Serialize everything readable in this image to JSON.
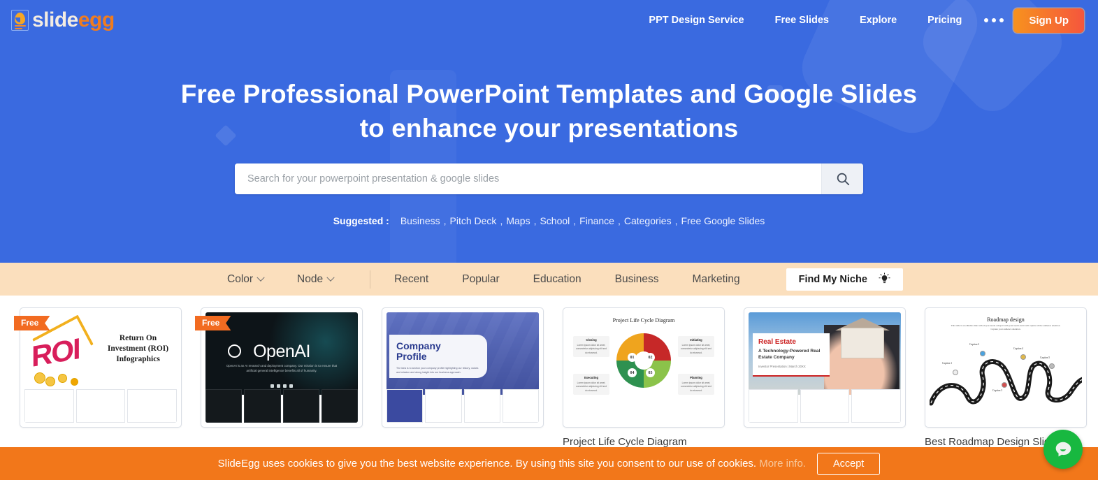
{
  "header": {
    "logo": {
      "part1": "slide",
      "part2": "egg",
      "icon": "egg-document-icon"
    },
    "nav": [
      {
        "label": "PPT Design Service"
      },
      {
        "label": "Free Slides"
      },
      {
        "label": "Explore"
      },
      {
        "label": "Pricing"
      }
    ],
    "more_icon": "ellipsis-icon",
    "signup_label": "Sign Up"
  },
  "hero": {
    "headline_line1": "Free Professional PowerPoint Templates and Google Slides",
    "headline_line2": "to enhance your presentations",
    "search": {
      "placeholder": "Search for your powerpoint presentation & google slides",
      "value": "",
      "button_icon": "search-icon"
    },
    "suggested_label": "Suggested :",
    "suggested": [
      "Business",
      "Pitch Deck",
      "Maps",
      "School",
      "Finance",
      "Categories",
      "Free Google Slides"
    ],
    "separator": ","
  },
  "filterbar": {
    "dropdowns": [
      {
        "label": "Color",
        "icon": "chevron-down-icon"
      },
      {
        "label": "Node",
        "icon": "chevron-down-icon"
      }
    ],
    "links": [
      "Recent",
      "Popular",
      "Education",
      "Business",
      "Marketing"
    ],
    "niche_button": {
      "label": "Find My Niche",
      "icon": "lightbulb-icon"
    }
  },
  "cards": [
    {
      "badge": "Free",
      "title": "",
      "art": {
        "kind": "roi",
        "heading": "Return On Investment (ROI) Infographics",
        "word": "ROI"
      }
    },
    {
      "badge": "Free",
      "title": "",
      "art": {
        "kind": "openai",
        "heading": "OpenAI",
        "subtext": "OpenAI is an AI research and deployment company. Our mission is to ensure that artificial general intelligence benefits all of humanity."
      }
    },
    {
      "badge": "",
      "title": "",
      "art": {
        "kind": "company-profile",
        "heading1": "Company",
        "heading2": "Profile",
        "subtext": "The idea is to section your company profile highlighting our history, values and mission and along insight into our business approach."
      }
    },
    {
      "badge": "",
      "title": "Project Life Cycle Diagram PowerPoint And Google Slides",
      "art": {
        "kind": "life-cycle",
        "heading": "Project Life Cycle Diagram",
        "numbers": [
          "01",
          "02",
          "03",
          "04"
        ],
        "labels": [
          {
            "title": "Closing",
            "body": "Lorem ipsum dolor sit amet, consectetur adipiscing elit sed do eiusmod."
          },
          {
            "title": "Initiating",
            "body": "Lorem ipsum dolor sit amet, consectetur adipiscing elit sed do eiusmod."
          },
          {
            "title": "Executing",
            "body": "Lorem ipsum dolor sit amet, consectetur adipiscing elit sed do eiusmod."
          },
          {
            "title": "Planning",
            "body": "Lorem ipsum dolor sit amet, consectetur adipiscing elit sed do eiusmod."
          }
        ]
      }
    },
    {
      "badge": "",
      "title": "",
      "art": {
        "kind": "real-estate",
        "heading": "Real Estate",
        "subheading": "A Technology-Powered Real Estate Company",
        "meta": "Investor Presentation | March 20XX"
      }
    },
    {
      "badge": "",
      "title": "Best Roadmap Design Slides Templates Presentations",
      "art": {
        "kind": "roadmap",
        "heading": "Roadmap design",
        "subtext": "This slide is an editable slide with all you needs. Adapt it with your needs and it will capture all the audience attention. Capture your audience attention.",
        "captions": [
          "Caption 1",
          "Caption 2",
          "Caption 3",
          "Caption 4",
          "Caption 5"
        ]
      }
    }
  ],
  "cookie": {
    "text": "SlideEgg uses cookies to give you the best website experience. By using this site you consent to our use of cookies.",
    "more_label": "More info.",
    "accept_label": "Accept"
  },
  "chat": {
    "icon": "chat-bubble-icon"
  },
  "colors": {
    "hero_blue": "#3a6ae0",
    "filter_peach": "#fbdfbd",
    "accent_orange": "#f2771a",
    "badge_orange": "#f26b21",
    "chat_green": "#18b840"
  }
}
